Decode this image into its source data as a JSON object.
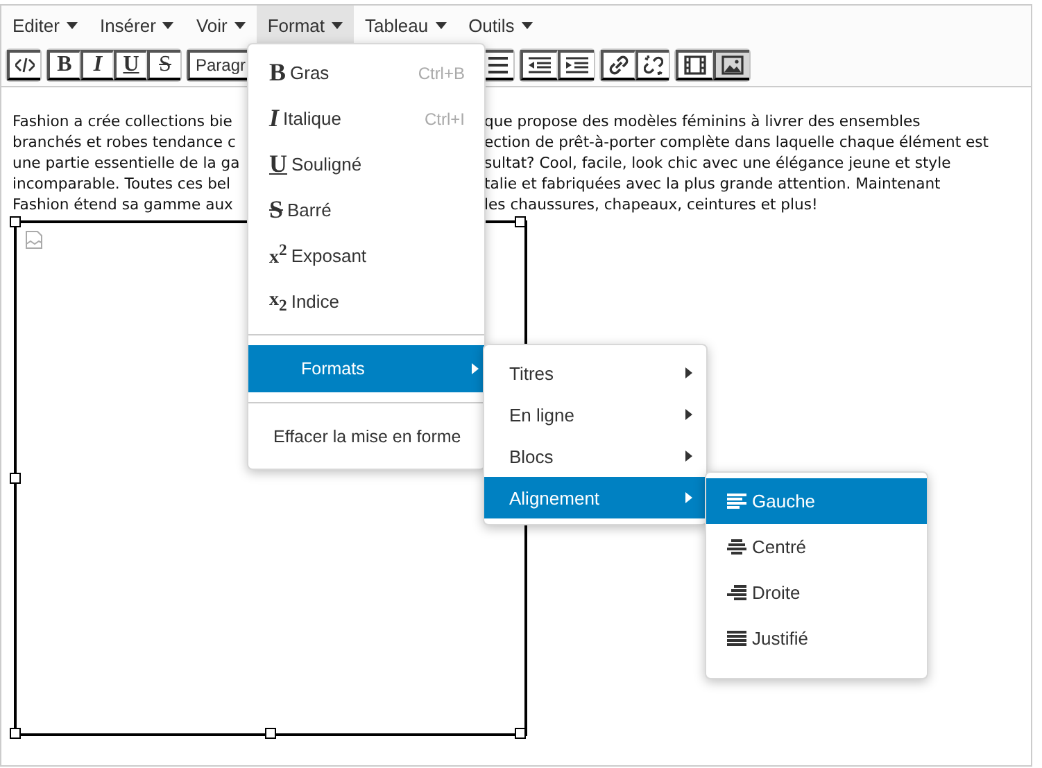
{
  "menubar": [
    {
      "label": "Editer",
      "selected": false
    },
    {
      "label": "Insérer",
      "selected": false
    },
    {
      "label": "Voir",
      "selected": false
    },
    {
      "label": "Format",
      "selected": true
    },
    {
      "label": "Tableau",
      "selected": false
    },
    {
      "label": "Outils",
      "selected": false
    }
  ],
  "toolbar": [
    {
      "buttons": [
        {
          "kind": "code",
          "pressed": false
        }
      ]
    },
    {
      "buttons": [
        {
          "kind": "bold",
          "glyph": "B",
          "pressed": false
        },
        {
          "kind": "italic",
          "glyph": "I",
          "pressed": false
        },
        {
          "kind": "underline",
          "glyph": "U",
          "pressed": false
        },
        {
          "kind": "strike",
          "glyph": "S",
          "pressed": false
        }
      ]
    },
    {
      "buttons": [
        {
          "kind": "dropdown",
          "label": "Paragr",
          "pressed": false
        }
      ]
    },
    {
      "buttons": [
        {
          "kind": "list",
          "pressed": false
        }
      ]
    },
    {
      "buttons": [
        {
          "kind": "outdent",
          "pressed": false
        },
        {
          "kind": "indent",
          "pressed": false
        }
      ]
    },
    {
      "buttons": [
        {
          "kind": "link",
          "pressed": false
        },
        {
          "kind": "unlink",
          "pressed": false
        }
      ]
    },
    {
      "buttons": [
        {
          "kind": "video",
          "pressed": false
        },
        {
          "kind": "image",
          "pressed": true
        }
      ]
    }
  ],
  "paragraph_lines": [
    {
      "left": "Fashion a crée collections bie",
      "right": "que propose des modèles féminins à livrer des ensembles"
    },
    {
      "left": "branchés et robes tendance c",
      "right": "ection de prêt-à-porter complète dans laquelle chaque élément est"
    },
    {
      "left": "une partie essentielle de la ga",
      "right": "sultat? Cool, facile, look chic avec une élégance jeune et style"
    },
    {
      "left": "incomparable. Toutes ces bel",
      "right": "talie et fabriquées avec la plus grande attention. Maintenant"
    },
    {
      "left": "Fashion étend sa gamme aux",
      "right": "les chaussures, chapeaux, ceintures et plus!"
    }
  ],
  "format_menu": [
    {
      "kind": "bold",
      "icon": "B",
      "label": "Gras",
      "shortcut": "Ctrl+B",
      "selected": false
    },
    {
      "kind": "italic",
      "icon": "I",
      "label": "Italique",
      "shortcut": "Ctrl+I",
      "selected": false
    },
    {
      "kind": "underline",
      "icon": "U",
      "label": "Souligné",
      "selected": false
    },
    {
      "kind": "strike",
      "icon": "S",
      "label": "Barré",
      "selected": false
    },
    {
      "kind": "superscript",
      "icon": "x$^{2}$",
      "label": "Exposant",
      "selected": false
    },
    {
      "kind": "subscript",
      "icon": "x$_{2}$",
      "label": "Indice",
      "selected": false
    },
    {
      "kind": "separator"
    },
    {
      "kind": "submenu",
      "label": "Formats",
      "selected": true
    },
    {
      "kind": "separator"
    },
    {
      "kind": "plain",
      "label": "Effacer la mise en forme",
      "selected": false
    }
  ],
  "formats_submenu": [
    {
      "label": "Titres",
      "selected": false
    },
    {
      "label": "En ligne",
      "selected": false
    },
    {
      "label": "Blocs",
      "selected": false
    },
    {
      "label": "Alignement",
      "selected": true
    }
  ],
  "alignment_submenu": [
    {
      "kind": "left",
      "label": "Gauche",
      "selected": true
    },
    {
      "kind": "center",
      "label": "Centré",
      "selected": false
    },
    {
      "kind": "right",
      "label": "Droite",
      "selected": false
    },
    {
      "kind": "justify",
      "label": "Justifié",
      "selected": false
    }
  ]
}
